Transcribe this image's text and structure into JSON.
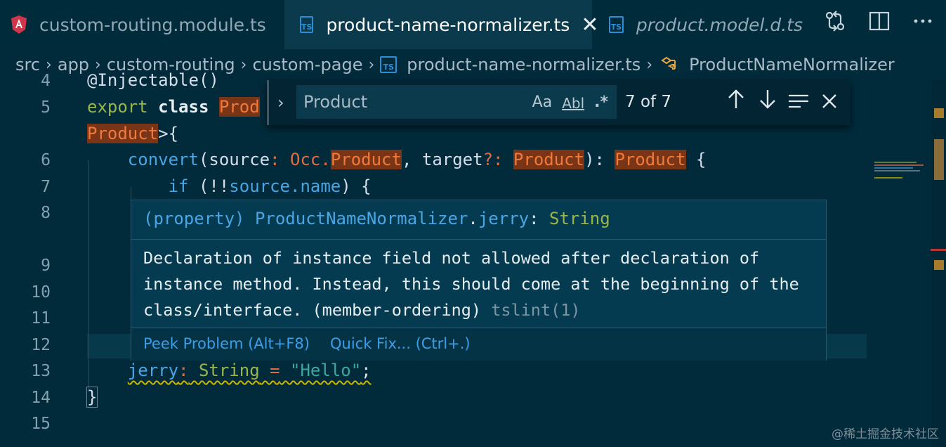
{
  "tabs": [
    {
      "label": "custom-routing.module.ts",
      "icon": "angular-icon",
      "active": false
    },
    {
      "label": "product-name-normalizer.ts",
      "icon": "ts-icon",
      "active": true
    },
    {
      "label": "product.model.d.ts",
      "icon": "ts-icon",
      "active": false
    }
  ],
  "ts_label": "TS",
  "close_glyph": "✕",
  "breadcrumb": {
    "items": [
      "src",
      "app",
      "custom-routing",
      "custom-page",
      "product-name-normalizer.ts",
      "ProductNameNormalizer"
    ],
    "sep": "›"
  },
  "find": {
    "value": "Product",
    "match_case": "Aa",
    "whole_word": "Abl",
    "regex": ".*",
    "count": "7 of 7",
    "toggle": "›"
  },
  "gutter": [
    "4",
    "5",
    "6",
    "7",
    "8",
    "9",
    "10",
    "11",
    "12",
    "13",
    "14",
    "15"
  ],
  "code": {
    "l4": "@Injectable()",
    "l5_kw1": "export",
    "l5_kw2": "class",
    "l5_name": "Prod",
    "l5b_name": "Product",
    "l5b_rest": ">{",
    "l6_fn": "convert",
    "l6_p1": "(source",
    "l6_colon": ":",
    "l6_ns": " Occ.",
    "l6_type": "Product",
    "l6_p2": ", target",
    "l6_opt": "?:",
    "l6_type2": "Product",
    "l6_p3": "):",
    "l6_type3": "Product",
    "l6_brace": " {",
    "l7_kw": "if",
    "l7_a": " (!!",
    "l7_b": "source",
    "l7_c": ".name",
    "l7_d": ") {",
    "l13_field": "jerry",
    "l13_colon": ":",
    "l13_type": " String",
    "l13_eq": " =",
    "l13_str": " \"Hello\"",
    "l13_end": ";",
    "l14": "}"
  },
  "hover": {
    "sig_kind": "(property)",
    "sig_class": "ProductNameNormalizer",
    "sig_dot": ".",
    "sig_field": "jerry",
    "sig_colon": ":",
    "sig_type": "String",
    "message": "Declaration of instance field not allowed after declaration of instance method. Instead, this should come at the beginning of the class/interface. (member-ordering)",
    "source": "tslint(1)",
    "peek_label": "Peek Problem (Alt+F8)",
    "quickfix_label": "Quick Fix... (Ctrl+.)"
  },
  "watermark": "@稀土掘金技术社区"
}
